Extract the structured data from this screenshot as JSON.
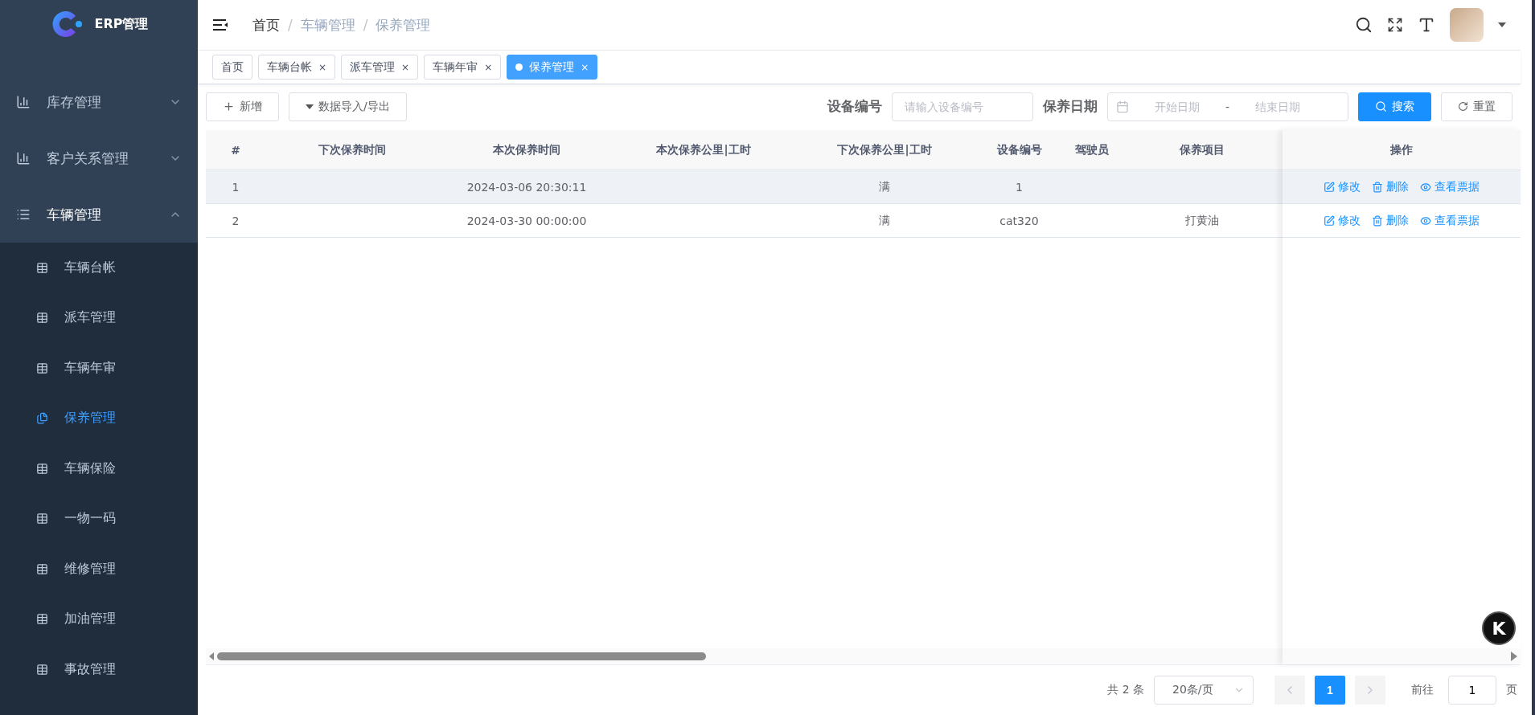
{
  "logo": {
    "title": "ERP管理"
  },
  "sidebar": {
    "items": [
      {
        "label": "库存管理",
        "expanded": false
      },
      {
        "label": "客户关系管理",
        "expanded": false
      },
      {
        "label": "车辆管理",
        "expanded": true,
        "children": [
          {
            "label": "车辆台帐",
            "selected": false
          },
          {
            "label": "派车管理",
            "selected": false
          },
          {
            "label": "车辆年审",
            "selected": false
          },
          {
            "label": "保养管理",
            "selected": true
          },
          {
            "label": "车辆保险",
            "selected": false
          },
          {
            "label": "一物一码",
            "selected": false
          },
          {
            "label": "维修管理",
            "selected": false
          },
          {
            "label": "加油管理",
            "selected": false
          },
          {
            "label": "事故管理",
            "selected": false
          }
        ]
      }
    ]
  },
  "breadcrumb": [
    "首页",
    "车辆管理",
    "保养管理"
  ],
  "breadcrumb_separator": "/",
  "tags": [
    {
      "label": "首页",
      "selected": false,
      "closable": false
    },
    {
      "label": "车辆台帐",
      "selected": false,
      "closable": true
    },
    {
      "label": "派车管理",
      "selected": false,
      "closable": true
    },
    {
      "label": "车辆年审",
      "selected": false,
      "closable": true
    },
    {
      "label": "保养管理",
      "selected": true,
      "closable": true
    }
  ],
  "close_mark": "×",
  "toolbar": {
    "add": "新增",
    "import_export": "数据导入/导出"
  },
  "filters": {
    "device_label": "设备编号",
    "device_placeholder": "请输入设备编号",
    "date_label": "保养日期",
    "start_placeholder": "开始日期",
    "separator": "-",
    "end_placeholder": "结束日期",
    "search": "搜索",
    "reset": "重置"
  },
  "table": {
    "columns": [
      "#",
      "下次保养时间",
      "本次保养时间",
      "本次保养公里|工时",
      "下次保养公里|工时",
      "设备编号",
      "驾驶员",
      "保养项目"
    ],
    "action_header": "操作",
    "rows": [
      {
        "highlighted": true,
        "cells": [
          "1",
          null,
          "2024-03-06 20:30:11",
          null,
          "满",
          "1",
          null,
          null
        ],
        "actions": [
          "修改",
          "删除",
          "查看票据"
        ]
      },
      {
        "highlighted": false,
        "cells": [
          "2",
          null,
          "2024-03-30 00:00:00",
          null,
          "满",
          "cat320",
          null,
          "打黄油"
        ],
        "actions": [
          "修改",
          "删除",
          "查看票据"
        ]
      }
    ]
  },
  "pagination": {
    "total": "共 2 条",
    "page_size": "20条/页",
    "pages": [
      {
        "label": "1",
        "selected": true
      }
    ],
    "goto": "前往",
    "page_input": "1",
    "page_unit": "页"
  },
  "floating_button": {
    "label": "K"
  }
}
